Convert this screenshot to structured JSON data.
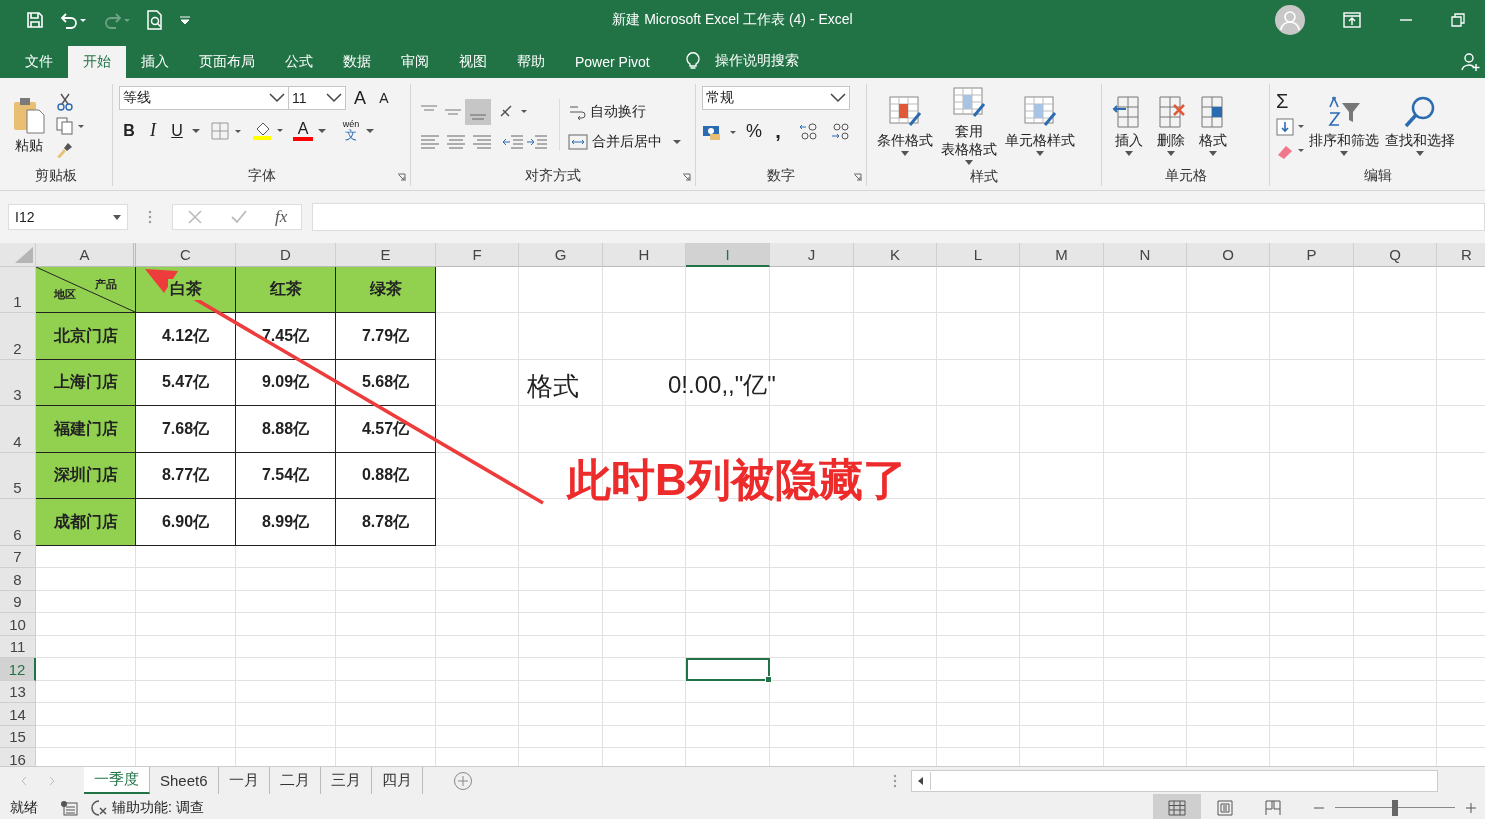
{
  "title_bar": {
    "title": "新建 Microsoft Excel 工作表 (4)  -  Excel"
  },
  "menu_tabs": [
    {
      "label": "文件",
      "selected": false
    },
    {
      "label": "开始",
      "selected": true
    },
    {
      "label": "插入",
      "selected": false
    },
    {
      "label": "页面布局",
      "selected": false
    },
    {
      "label": "公式",
      "selected": false
    },
    {
      "label": "数据",
      "selected": false
    },
    {
      "label": "审阅",
      "selected": false
    },
    {
      "label": "视图",
      "selected": false
    },
    {
      "label": "帮助",
      "selected": false
    },
    {
      "label": "Power Pivot",
      "selected": false
    }
  ],
  "tell_me": "操作说明搜索",
  "ribbon": {
    "clipboard": {
      "label": "剪贴板",
      "paste": "粘贴"
    },
    "font": {
      "label": "字体",
      "family": "等线",
      "size": "11",
      "grow": "A",
      "shrink": "A",
      "bold": "B",
      "italic": "I",
      "underline": "U",
      "color_letter": "A",
      "phonetic_top": "wén",
      "phonetic_bottom": "文"
    },
    "alignment": {
      "label": "对齐方式",
      "wrap": "自动换行",
      "merge": "合并后居中"
    },
    "number": {
      "label": "数字",
      "format": "常规",
      "percent": "%",
      "comma": ","
    },
    "styles": {
      "label": "样式",
      "buttons": [
        {
          "lines": [
            "条件格式"
          ]
        },
        {
          "lines": [
            "套用",
            "表格格式"
          ]
        },
        {
          "lines": [
            "单元格样式"
          ]
        }
      ]
    },
    "cells": {
      "label": "单元格",
      "buttons": [
        "插入",
        "删除",
        "格式"
      ]
    },
    "editing": {
      "label": "编辑",
      "sum": "Σ",
      "buttons": [
        "排序和筛选",
        "查找和选择"
      ]
    }
  },
  "formula_bar": {
    "name_box": "I12",
    "fx": "fx"
  },
  "columns": [
    {
      "label": "A",
      "selected": false
    },
    {
      "label": "C",
      "selected": false
    },
    {
      "label": "D",
      "selected": false
    },
    {
      "label": "E",
      "selected": false
    },
    {
      "label": "F",
      "selected": false
    },
    {
      "label": "G",
      "selected": false
    },
    {
      "label": "H",
      "selected": false
    },
    {
      "label": "I",
      "selected": true
    },
    {
      "label": "J",
      "selected": false
    },
    {
      "label": "K",
      "selected": false
    },
    {
      "label": "L",
      "selected": false
    },
    {
      "label": "M",
      "selected": false
    },
    {
      "label": "N",
      "selected": false
    },
    {
      "label": "O",
      "selected": false
    },
    {
      "label": "P",
      "selected": false
    },
    {
      "label": "Q",
      "selected": false
    },
    {
      "label": "R",
      "selected": false
    }
  ],
  "rows": [
    {
      "label": "1",
      "selected": false
    },
    {
      "label": "2",
      "selected": false
    },
    {
      "label": "3",
      "selected": false
    },
    {
      "label": "4",
      "selected": false
    },
    {
      "label": "5",
      "selected": false
    },
    {
      "label": "6",
      "selected": false
    },
    {
      "label": "7",
      "selected": false
    },
    {
      "label": "8",
      "selected": false
    },
    {
      "label": "9",
      "selected": false
    },
    {
      "label": "10",
      "selected": false
    },
    {
      "label": "11",
      "selected": false
    },
    {
      "label": "12",
      "selected": true
    },
    {
      "label": "13",
      "selected": false
    },
    {
      "label": "14",
      "selected": false
    },
    {
      "label": "15",
      "selected": false
    },
    {
      "label": "16",
      "selected": false
    }
  ],
  "table": {
    "corner_top": "产品",
    "corner_bottom": "地区",
    "headers": [
      "白茶",
      "红茶",
      "绿茶"
    ],
    "rows": [
      {
        "region": "北京门店",
        "values": [
          "4.12亿",
          "7.45亿",
          "7.79亿"
        ]
      },
      {
        "region": "上海门店",
        "values": [
          "5.47亿",
          "9.09亿",
          "5.68亿"
        ]
      },
      {
        "region": "福建门店",
        "values": [
          "7.68亿",
          "8.88亿",
          "4.57亿"
        ]
      },
      {
        "region": "深圳门店",
        "values": [
          "8.77亿",
          "7.54亿",
          "0.88亿"
        ]
      },
      {
        "region": "成都门店",
        "values": [
          "6.90亿",
          "8.99亿",
          "8.78亿"
        ]
      }
    ]
  },
  "notes": {
    "label": "格式",
    "format": "0!.00,,\"亿\"",
    "callout": "此时B列被隐藏了"
  },
  "sheet_tabs": [
    {
      "label": "一季度",
      "selected": true
    },
    {
      "label": "Sheet6",
      "selected": false
    },
    {
      "label": "一月",
      "selected": false
    },
    {
      "label": "二月",
      "selected": false
    },
    {
      "label": "三月",
      "selected": false
    },
    {
      "label": "四月",
      "selected": false
    }
  ],
  "status_bar": {
    "ready": "就绪",
    "accessibility": "辅助功能: 调查",
    "zoom": {
      "level": 0.5
    }
  }
}
